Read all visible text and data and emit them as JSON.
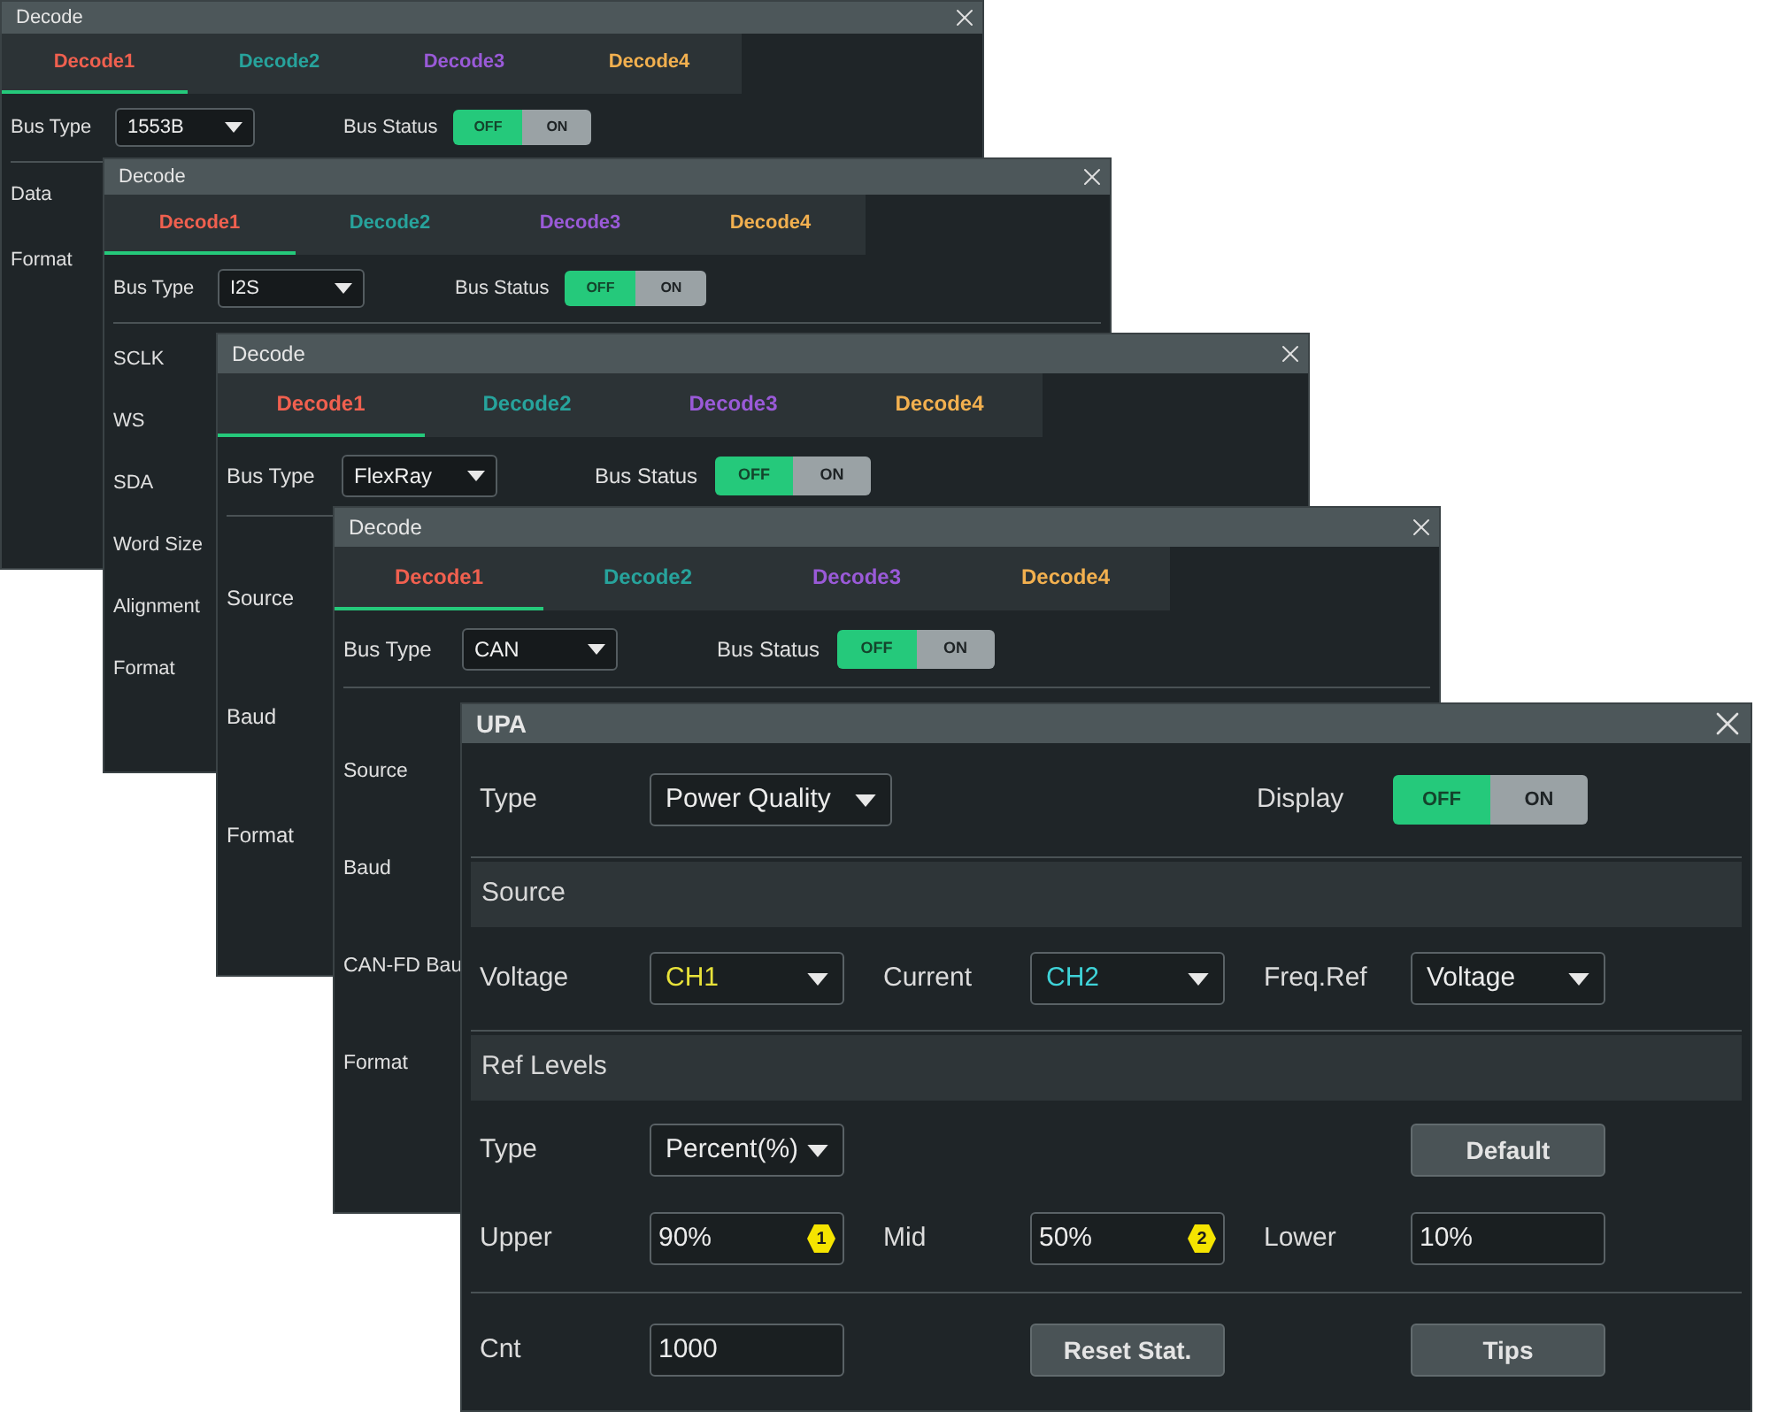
{
  "windows": [
    {
      "kind": "decode",
      "title": "Decode",
      "tabs": [
        {
          "label": "Decode1",
          "selected": true,
          "color": "#f0604f"
        },
        {
          "label": "Decode2",
          "selected": false,
          "color": "#27a39c"
        },
        {
          "label": "Decode3",
          "selected": false,
          "color": "#9a5ad8"
        },
        {
          "label": "Decode4",
          "selected": false,
          "color": "#f2b04f"
        }
      ],
      "bus_type": {
        "label": "Bus Type",
        "value": "1553B"
      },
      "bus_status": {
        "label": "Bus Status",
        "on": false,
        "off_label": "OFF",
        "on_label": "ON"
      },
      "fields": [
        "Data",
        "Format"
      ]
    },
    {
      "kind": "decode",
      "title": "Decode",
      "tabs": [
        {
          "label": "Decode1",
          "selected": true,
          "color": "#f0604f"
        },
        {
          "label": "Decode2",
          "selected": false,
          "color": "#27a39c"
        },
        {
          "label": "Decode3",
          "selected": false,
          "color": "#9a5ad8"
        },
        {
          "label": "Decode4",
          "selected": false,
          "color": "#f2b04f"
        }
      ],
      "bus_type": {
        "label": "Bus Type",
        "value": "I2S"
      },
      "bus_status": {
        "label": "Bus Status",
        "on": false,
        "off_label": "OFF",
        "on_label": "ON"
      },
      "fields": [
        "SCLK",
        "WS",
        "SDA",
        "Word Size",
        "Alignment",
        "Format"
      ]
    },
    {
      "kind": "decode",
      "title": "Decode",
      "tabs": [
        {
          "label": "Decode1",
          "selected": true,
          "color": "#f0604f"
        },
        {
          "label": "Decode2",
          "selected": false,
          "color": "#27a39c"
        },
        {
          "label": "Decode3",
          "selected": false,
          "color": "#9a5ad8"
        },
        {
          "label": "Decode4",
          "selected": false,
          "color": "#f2b04f"
        }
      ],
      "bus_type": {
        "label": "Bus Type",
        "value": "FlexRay"
      },
      "bus_status": {
        "label": "Bus Status",
        "on": false,
        "off_label": "OFF",
        "on_label": "ON"
      },
      "fields": [
        "Source",
        "Baud",
        "Format"
      ]
    },
    {
      "kind": "decode",
      "title": "Decode",
      "tabs": [
        {
          "label": "Decode1",
          "selected": true,
          "color": "#f0604f"
        },
        {
          "label": "Decode2",
          "selected": false,
          "color": "#27a39c"
        },
        {
          "label": "Decode3",
          "selected": false,
          "color": "#9a5ad8"
        },
        {
          "label": "Decode4",
          "selected": false,
          "color": "#f2b04f"
        }
      ],
      "bus_type": {
        "label": "Bus Type",
        "value": "CAN"
      },
      "bus_status": {
        "label": "Bus Status",
        "on": false,
        "off_label": "OFF",
        "on_label": "ON"
      },
      "fields": [
        "Source",
        "Baud",
        "CAN-FD Bau",
        "Format"
      ]
    },
    {
      "kind": "upa",
      "title": "UPA",
      "type": {
        "label": "Type",
        "value": "Power Quality"
      },
      "display": {
        "label": "Display",
        "on": false,
        "off_label": "OFF",
        "on_label": "ON"
      },
      "sections": [
        {
          "title": "Source",
          "rows": [
            [
              {
                "kind": "select",
                "label": "Voltage",
                "value": "CH1",
                "color": "#e8e23a"
              },
              {
                "kind": "select",
                "label": "Current",
                "value": "CH2",
                "color": "#3fd3d8"
              },
              {
                "kind": "select",
                "label": "Freq.Ref",
                "value": "Voltage"
              }
            ]
          ]
        },
        {
          "title": "Ref Levels",
          "rows": [
            [
              {
                "kind": "select",
                "label": "Type",
                "value": "Percent(%)"
              },
              {
                "kind": "empty"
              },
              {
                "kind": "button",
                "label": "Default"
              }
            ],
            [
              {
                "kind": "input",
                "label": "Upper",
                "value": "90%",
                "marker": "1"
              },
              {
                "kind": "input",
                "label": "Mid",
                "value": "50%",
                "marker": "2"
              },
              {
                "kind": "input",
                "label": "Lower",
                "value": "10%"
              }
            ]
          ]
        },
        {
          "rows": [
            [
              {
                "kind": "input",
                "label": "Cnt",
                "value": "1000"
              },
              {
                "kind": "button",
                "label": "Reset Stat."
              },
              {
                "kind": "button",
                "label": "Tips"
              }
            ]
          ]
        }
      ]
    }
  ]
}
